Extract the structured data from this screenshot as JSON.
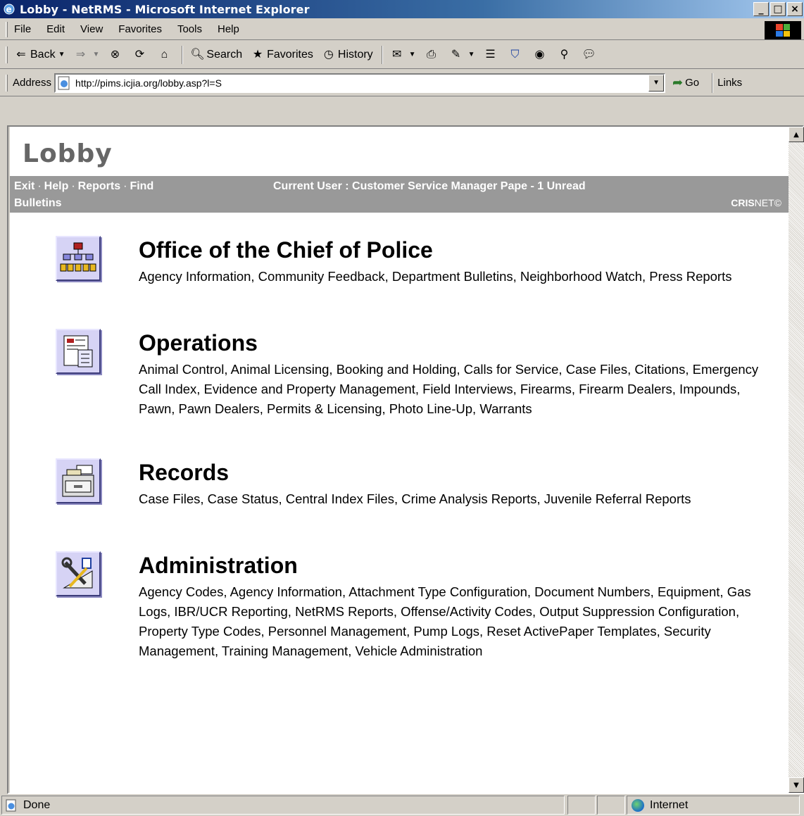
{
  "window": {
    "title": "Lobby - NetRMS - Microsoft Internet Explorer",
    "minimize": "_",
    "maximize": "□",
    "close": "×"
  },
  "menu": {
    "items": [
      {
        "label": "File"
      },
      {
        "label": "Edit"
      },
      {
        "label": "View"
      },
      {
        "label": "Favorites"
      },
      {
        "label": "Tools"
      },
      {
        "label": "Help"
      }
    ]
  },
  "toolbar": {
    "back": "Back",
    "search": "Search",
    "favorites": "Favorites",
    "history": "History"
  },
  "address": {
    "label": "Address",
    "url": "http://pims.icjia.org/lobby.asp?l=S",
    "go": "Go",
    "links": "Links"
  },
  "page": {
    "heading": "Lobby",
    "nav": {
      "exit": "Exit",
      "help": "Help",
      "reports": "Reports",
      "find": "Find",
      "bulletins": "Bulletins",
      "separator": "·"
    },
    "current_user": "Current User : Customer Service Manager Pape - 1 Unread",
    "brand_bold": "CRIS",
    "brand_rest": "NET©",
    "sections": [
      {
        "title": "Office of the Chief of Police",
        "icon": "org-chart-icon",
        "items": "Agency Information, Community Feedback, Department Bulletins, Neighborhood Watch, Press Reports"
      },
      {
        "title": "Operations",
        "icon": "form-list-icon",
        "items": "Animal Control, Animal Licensing, Booking and Holding, Calls for Service, Case Files, Citations, Emergency Call Index, Evidence and Property Management, Field Interviews, Firearms, Firearm Dealers, Impounds, Pawn, Pawn Dealers, Permits & Licensing, Photo Line-Up, Warrants"
      },
      {
        "title": "Records",
        "icon": "file-drawer-icon",
        "items": "Case Files, Case Status, Central Index Files, Crime Analysis Reports, Juvenile Referral Reports"
      },
      {
        "title": "Administration",
        "icon": "tools-icon",
        "items": "Agency Codes, Agency Information, Attachment Type Configuration, Document Numbers, Equipment, Gas Logs, IBR/UCR Reporting, NetRMS Reports, Offense/Activity Codes, Output Suppression Configuration, Property Type Codes, Personnel Management, Pump Logs, Reset ActivePaper Templates, Security Management, Training Management, Vehicle Administration"
      }
    ]
  },
  "status": {
    "text": "Done",
    "zone": "Internet"
  },
  "colors": {
    "title_bar": "#0a246a",
    "user_bar": "#999999",
    "heading": "#666666",
    "icon_bg": "#d6d3f5"
  }
}
